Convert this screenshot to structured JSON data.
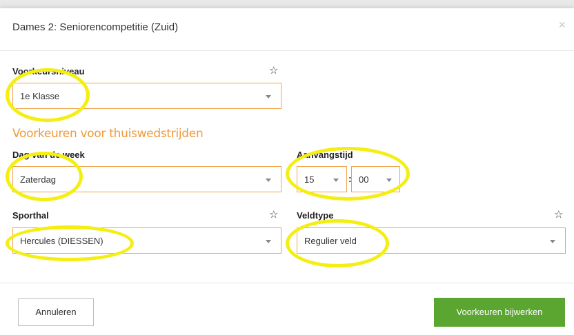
{
  "modal": {
    "title": "Dames 2: Seniorencompetitie (Zuid)",
    "close_glyph": "×"
  },
  "fields": {
    "niveau": {
      "label": "Voorkeursniveau",
      "value": "1e Klasse"
    },
    "section_title": "Voorkeuren voor thuiswedstrijden",
    "dag": {
      "label": "Dag van de week",
      "value": "Zaterdag"
    },
    "aanvang": {
      "label": "Aanvangstijd",
      "hour": "15",
      "minute": "00",
      "separator": ":"
    },
    "sporthal": {
      "label": "Sporthal",
      "value": "Hercules (DIESSEN)"
    },
    "veldtype": {
      "label": "Veldtype",
      "value": "Regulier veld"
    }
  },
  "icons": {
    "star": "☆"
  },
  "footer": {
    "cancel_label": "Annuleren",
    "submit_label": "Voorkeuren bijwerken"
  },
  "colors": {
    "accent_orange": "#f09a3a",
    "field_border": "#f0a24b",
    "primary_green": "#5aa630",
    "highlight_yellow": "#f4ee12"
  }
}
